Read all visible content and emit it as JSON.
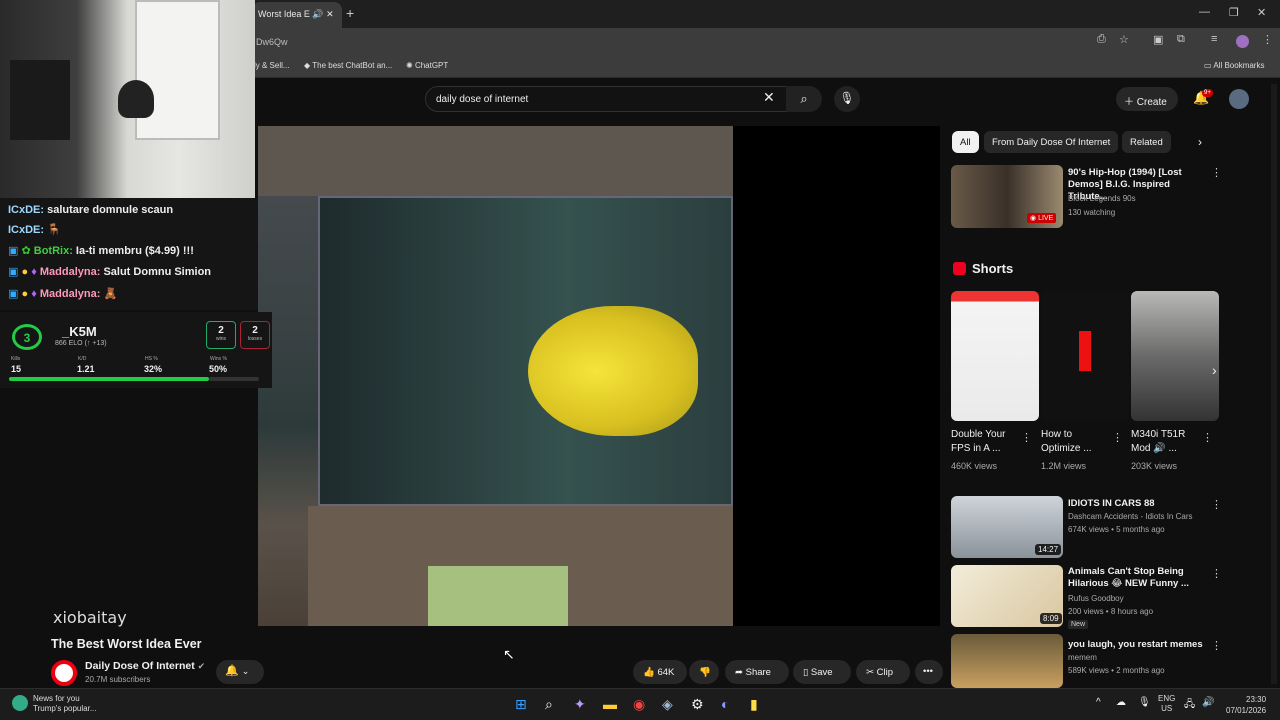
{
  "browser": {
    "tab_title": "Worst Idea E",
    "address": "Dw6Qw",
    "bookmarks": [
      "ly & Sell...",
      "The best ChatBot an...",
      "ChatGPT"
    ],
    "all_bookmarks": "All Bookmarks"
  },
  "header": {
    "search_value": "daily dose of internet",
    "create_label": "Create",
    "notif_badge": "9+"
  },
  "stream": {
    "chat": [
      {
        "user": "ICxDE:",
        "text": "salutare domnule scaun"
      },
      {
        "user": "ICxDE:",
        "text": ""
      },
      {
        "user": "BotRix:",
        "text": "Ia-ti membru ($4.99) !!!"
      },
      {
        "user": "Maddalyna:",
        "text": "Salut Domnu Simion"
      },
      {
        "user": "Maddalyna:",
        "text": ""
      }
    ],
    "stats": {
      "level": "3",
      "name": "_K5M",
      "elo": "866 ELO (↑ +13)",
      "wins": "2",
      "wins_label": "wins",
      "losses": "2",
      "losses_label": "losses",
      "kills_label": "Kills",
      "kills": "15",
      "kd_label": "K/D",
      "kd": "1.21",
      "hs_label": "HS %",
      "hs": "32%",
      "winrate_label": "Wins %",
      "winrate": "50%"
    },
    "watermark": "xiobaitay"
  },
  "video": {
    "title": "The Best Worst Idea Ever",
    "channel": "Daily Dose Of Internet",
    "subscribers": "20.7M subscribers",
    "likes": "64K",
    "share": "Share",
    "save": "Save",
    "clip": "Clip"
  },
  "chips": [
    "All",
    "From Daily Dose Of Internet",
    "Related"
  ],
  "recommended_top": {
    "title": "90's Hip-Hop (1994) [Lost Demos] B.I.G. Inspired Tribute...",
    "channel": "Block Legends 90s",
    "meta": "130 watching",
    "live": "LIVE"
  },
  "shorts": {
    "header": "Shorts",
    "items": [
      {
        "title": "Double Your FPS in A ...",
        "views": "460K views"
      },
      {
        "title": "How to Optimize ...",
        "views": "1.2M views"
      },
      {
        "title": "M340i T51R Mod 🔊 ...",
        "views": "203K views"
      }
    ]
  },
  "recommended": [
    {
      "title": "IDIOTS IN CARS 88",
      "channel": "Dashcam Accidents - Idiots In Cars",
      "meta": "674K views • 5 months ago",
      "duration": "14:27",
      "badge": ""
    },
    {
      "title": "Animals Can't Stop Being Hilarious 😂 NEW Funny ...",
      "channel": "Rufus Goodboy",
      "meta": "200 views • 8 hours ago",
      "duration": "8:09",
      "badge": "New"
    },
    {
      "title": "you laugh, you restart memes",
      "channel": "memem",
      "meta": "589K views • 2 months ago",
      "duration": "",
      "badge": ""
    }
  ],
  "taskbar": {
    "news_title": "News for you",
    "news_sub": "Trump's popular...",
    "lang": "ENG",
    "region": "US",
    "time": "23:30",
    "date": "07/01/2026"
  }
}
